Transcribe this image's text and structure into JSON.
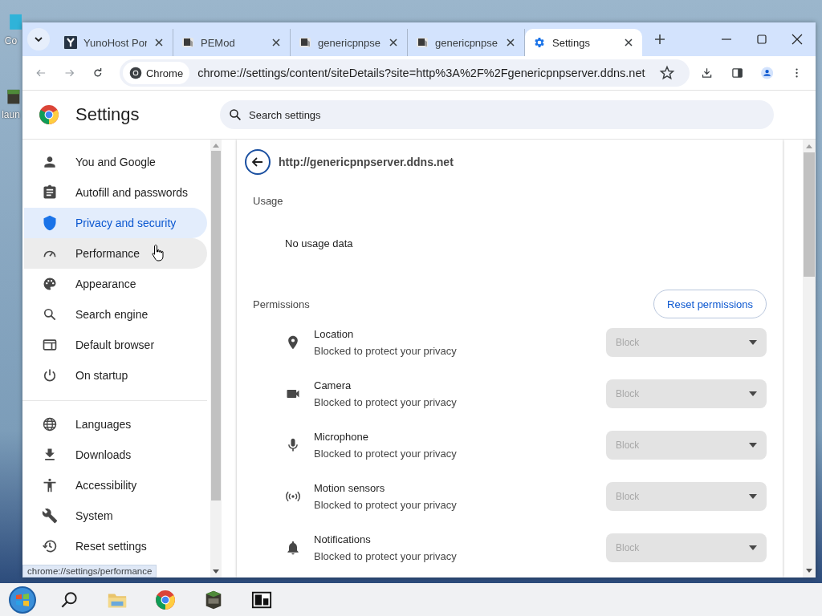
{
  "desktop": {
    "icons": [
      {
        "label": "Co",
        "kind": "monitor"
      },
      {
        "label": "laun",
        "kind": "game"
      }
    ]
  },
  "tabs": [
    {
      "title": "YunoHost Por",
      "selected": false
    },
    {
      "title": "PEMod",
      "selected": false
    },
    {
      "title": "genericpnpse",
      "selected": false
    },
    {
      "title": "genericpnpse",
      "selected": false
    },
    {
      "title": "Settings",
      "selected": true
    }
  ],
  "toolbar": {
    "chip": "Chrome",
    "url": "chrome://settings/content/siteDetails?site=http%3A%2F%2Fgenericpnpserver.ddns.net"
  },
  "header": {
    "title": "Settings",
    "search_placeholder": "Search settings"
  },
  "nav": {
    "groups": [
      [
        {
          "label": "You and Google",
          "selected": false,
          "hovered": false
        },
        {
          "label": "Autofill and passwords",
          "selected": false,
          "hovered": false
        },
        {
          "label": "Privacy and security",
          "selected": true,
          "hovered": false
        },
        {
          "label": "Performance",
          "selected": false,
          "hovered": true
        },
        {
          "label": "Appearance",
          "selected": false,
          "hovered": false
        },
        {
          "label": "Search engine",
          "selected": false,
          "hovered": false
        },
        {
          "label": "Default browser",
          "selected": false,
          "hovered": false
        },
        {
          "label": "On startup",
          "selected": false,
          "hovered": false
        }
      ],
      [
        {
          "label": "Languages",
          "selected": false,
          "hovered": false
        },
        {
          "label": "Downloads",
          "selected": false,
          "hovered": false
        },
        {
          "label": "Accessibility",
          "selected": false,
          "hovered": false
        },
        {
          "label": "System",
          "selected": false,
          "hovered": false
        },
        {
          "label": "Reset settings",
          "selected": false,
          "hovered": false
        }
      ]
    ]
  },
  "site": {
    "title": "http://genericpnpserver.ddns.net",
    "usage": {
      "heading": "Usage",
      "text": "No usage data"
    },
    "permissions": {
      "heading": "Permissions",
      "reset_button": "Reset permissions",
      "rows": [
        {
          "kind": "location",
          "label": "Location",
          "description": "Blocked to protect your privacy",
          "value": "Block",
          "disabled": true
        },
        {
          "kind": "camera",
          "label": "Camera",
          "description": "Blocked to protect your privacy",
          "value": "Block",
          "disabled": true
        },
        {
          "kind": "microphone",
          "label": "Microphone",
          "description": "Blocked to protect your privacy",
          "value": "Block",
          "disabled": true
        },
        {
          "kind": "sensors",
          "label": "Motion sensors",
          "description": "Blocked to protect your privacy",
          "value": "Block",
          "disabled": true
        },
        {
          "kind": "notifications",
          "label": "Notifications",
          "description": "Blocked to protect your privacy",
          "value": "Block",
          "disabled": true
        }
      ]
    }
  },
  "status_tooltip": "chrome://settings/performance",
  "taskbar": {
    "apps": [
      {
        "kind": "start"
      },
      {
        "kind": "search"
      },
      {
        "kind": "folder"
      },
      {
        "kind": "chrome"
      },
      {
        "kind": "game"
      },
      {
        "kind": "archiver"
      }
    ]
  }
}
